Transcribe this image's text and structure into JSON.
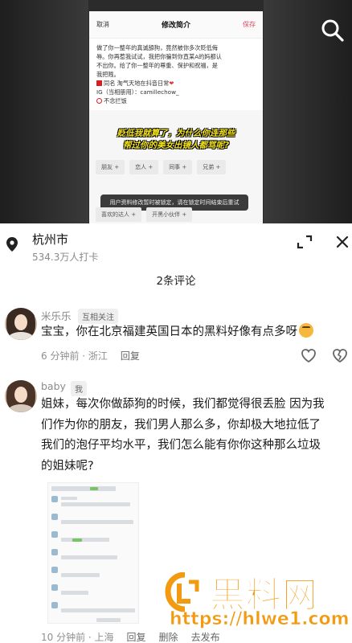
{
  "video": {
    "header": {
      "cancel": "取消",
      "title": "修改简介",
      "save": "保存"
    },
    "bio_lines": [
      "做了你一整年的真诚舔狗，竟然被你多次贬低侮",
      "辱。你再惹我试试，我把你骗到你直某A的妈都认",
      "不出你。给了你一整年的尊重、保护和祝福，是",
      "我把贱。"
    ],
    "bio_name_line": "同名  淘气天地在抖音日常",
    "bio_ig_line": "IG（当相册用）：camillechow_",
    "bio_block_line": "不念拦饭",
    "caption_line1": "贬低我就算了，为什么你连那些",
    "caption_line2": "帮过你的美女出镜人都骂呢?",
    "tags_row1": [
      "朋友 +",
      "恋人 +",
      "同事 +",
      "兄弟 +"
    ],
    "tags_row2": [
      "喜欢的达人 +",
      "开黑小伙伴 +"
    ],
    "toast": "用户资料修改暂时被锁定，请在锁定时间结束后重试"
  },
  "location": {
    "city": "杭州市",
    "checkins": "534.3万人打卡"
  },
  "comments_header": {
    "count_label": "2条评论"
  },
  "comments": [
    {
      "username": "米乐乐",
      "badge": "互相关注",
      "text": "宝宝，你在北京福建英国日本的黑料好像有点多呀",
      "time_location": "6 分钟前 · 浙江",
      "reply": "回复"
    },
    {
      "username": "baby",
      "badge": "我",
      "text_lines": [
        "姐妹，每次你做舔狗的时候，我们都觉得很丢脸  因为我",
        "们作为你的朋友，我们男人那么多，你却极大地拉低了",
        "我们的泡仔平均水平，我们怎么能有你你这种那么垃圾",
        "的姐妹呢?"
      ],
      "time_location": "10 分钟前 · 上海",
      "reply": "回复",
      "delete": "删除",
      "publish": "去发布"
    }
  ],
  "watermark": {
    "brand": "黑料网",
    "url": "https://hlwe1.com"
  },
  "colors": {
    "accent_red": "#e4475d",
    "watermark_orange": "#f29b12",
    "caption_yellow": "#f5e51b"
  },
  "icons": [
    "search-icon",
    "location-pin-icon",
    "expand-icon",
    "close-icon",
    "like-icon",
    "dislike-icon"
  ]
}
